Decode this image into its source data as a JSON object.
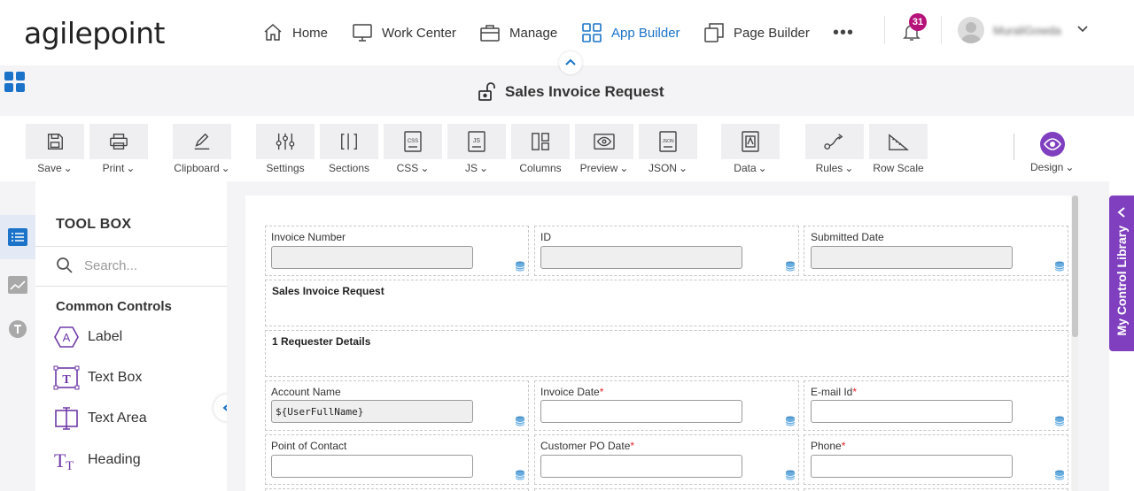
{
  "app": {
    "logo": "agilepoint"
  },
  "nav": {
    "home": "Home",
    "work_center": "Work Center",
    "manage": "Manage",
    "app_builder": "App Builder",
    "page_builder": "Page Builder",
    "more": "•••"
  },
  "notifications": {
    "count": "31"
  },
  "user": {
    "name": "MuraliGowda"
  },
  "page": {
    "title": "Sales Invoice Request"
  },
  "toolbar": {
    "save": "Save",
    "print": "Print",
    "clipboard": "Clipboard",
    "settings": "Settings",
    "sections": "Sections",
    "css": "CSS",
    "js": "JS",
    "columns": "Columns",
    "preview": "Preview",
    "json": "JSON",
    "data": "Data",
    "rules": "Rules",
    "row_scale": "Row Scale",
    "design": "Design"
  },
  "toolbox": {
    "title": "TOOL BOX",
    "search_placeholder": "Search...",
    "section_title": "Common Controls",
    "items": [
      {
        "label": "Label",
        "icon": "label-icon"
      },
      {
        "label": "Text Box",
        "icon": "textbox-icon"
      },
      {
        "label": "Text Area",
        "icon": "textarea-icon"
      },
      {
        "label": "Heading",
        "icon": "heading-icon"
      }
    ]
  },
  "form": {
    "row1": [
      {
        "label": "Invoice Number",
        "value": "",
        "required": false
      },
      {
        "label": "ID",
        "value": "",
        "required": false
      },
      {
        "label": "Submitted Date",
        "value": "",
        "required": false
      }
    ],
    "section1": "Sales Invoice Request",
    "section2": "1 Requester Details",
    "row2": [
      {
        "label": "Account Name",
        "value": "${UserFullName}",
        "required": false
      },
      {
        "label": "Invoice Date",
        "value": "",
        "required": true
      },
      {
        "label": "E-mail Id",
        "value": "",
        "required": true
      }
    ],
    "row3": [
      {
        "label": "Point of Contact",
        "value": "",
        "required": false
      },
      {
        "label": "Customer PO Date",
        "value": "",
        "required": true
      },
      {
        "label": "Phone",
        "value": "",
        "required": true
      }
    ],
    "required_mark": "*"
  },
  "side_panel": {
    "label": "My Control Library"
  },
  "colors": {
    "accent": "#1a73c8",
    "purple": "#7f3fbf",
    "badge": "#b5127a",
    "required": "#e0262e"
  }
}
